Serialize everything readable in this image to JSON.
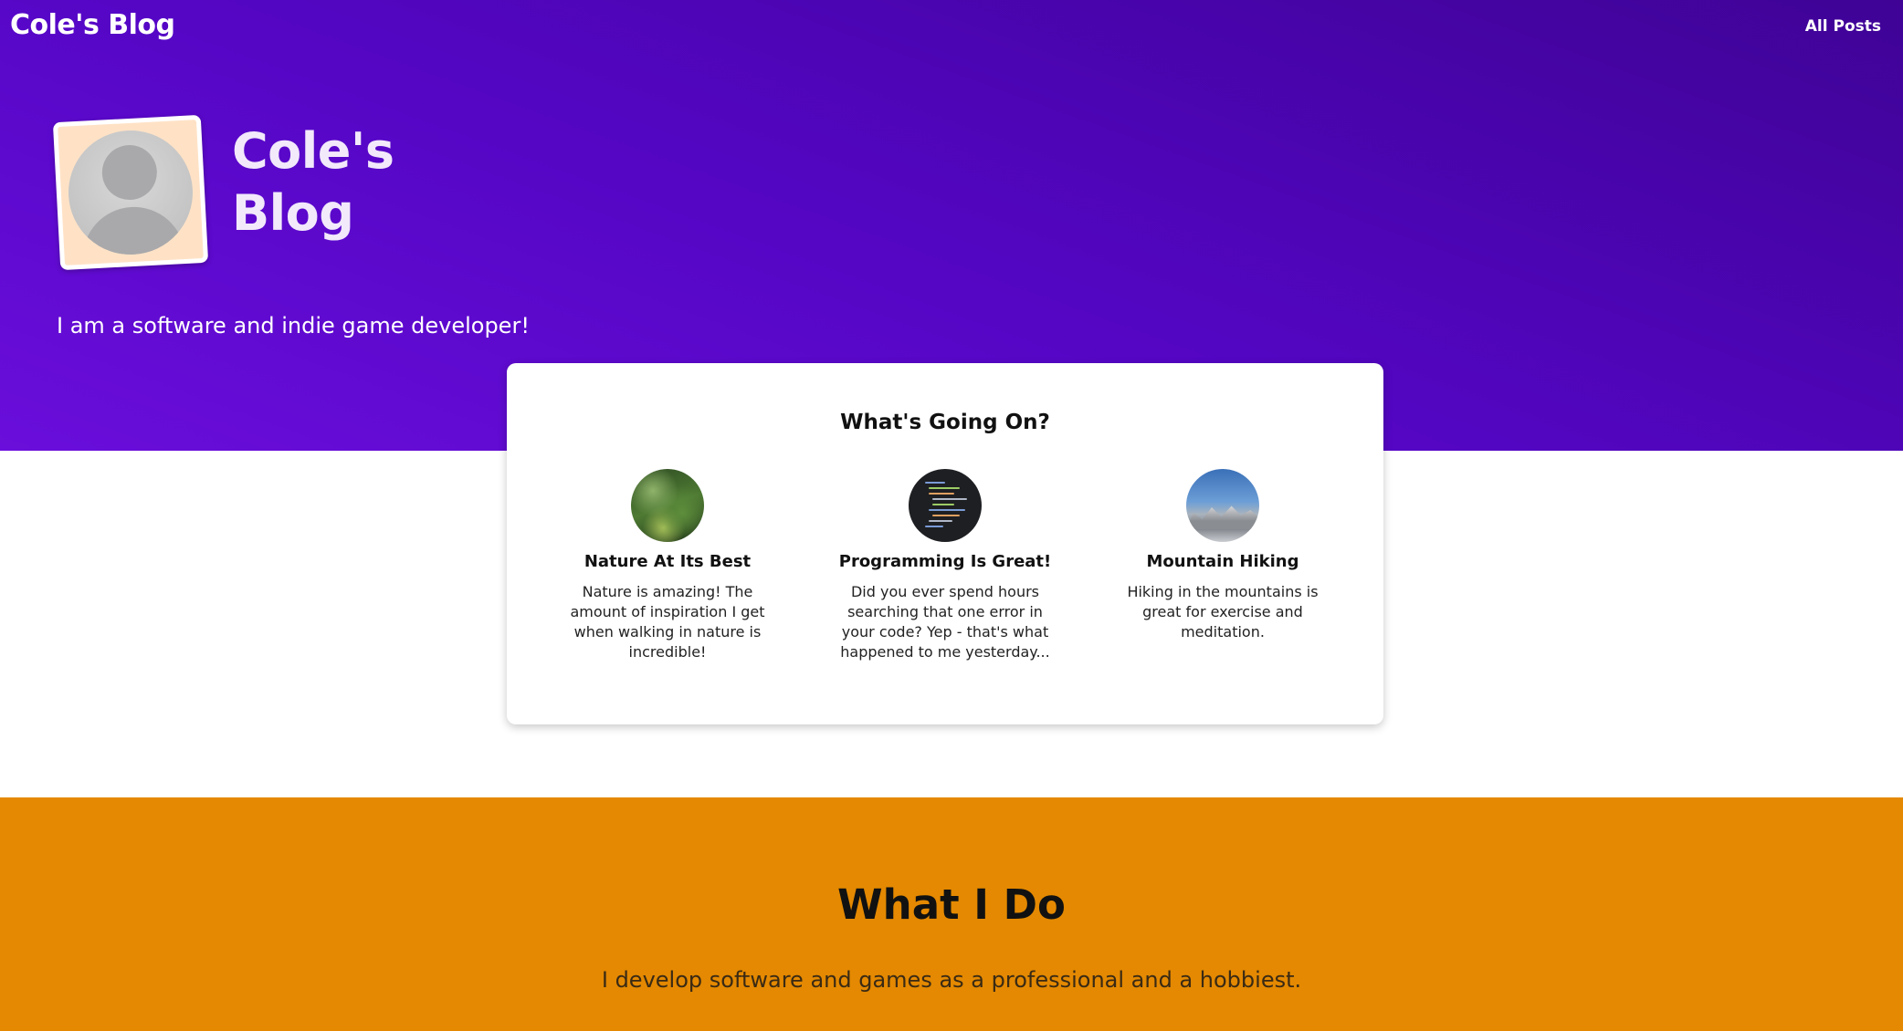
{
  "nav": {
    "brand": "Cole's Blog",
    "all_posts": "All Posts"
  },
  "hero": {
    "title": "Cole's Blog",
    "tagline": "I am a software and indie game developer!",
    "avatar_icon": "default-user-avatar-icon"
  },
  "featured": {
    "heading": "What's Going On?",
    "posts": [
      {
        "title": "Nature At Its Best",
        "description": "Nature is amazing! The amount of inspiration I get when walking in nature is incredible!",
        "thumbnail": "forest-photo"
      },
      {
        "title": "Programming Is Great!",
        "description": "Did you ever spend hours searching that one error in your code? Yep - that's what happened to me yesterday...",
        "thumbnail": "code-editor-photo"
      },
      {
        "title": "Mountain Hiking",
        "description": "Hiking in the mountains is great for exercise and meditation.",
        "thumbnail": "mountain-photo"
      }
    ]
  },
  "what_i_do": {
    "title": "What I Do",
    "text": "I develop software and games as a professional and a hobbiest."
  },
  "colors": {
    "hero_purple": "#5406c4",
    "section_orange": "#e48901",
    "avatar_frame_peach": "#ffe2c6"
  }
}
